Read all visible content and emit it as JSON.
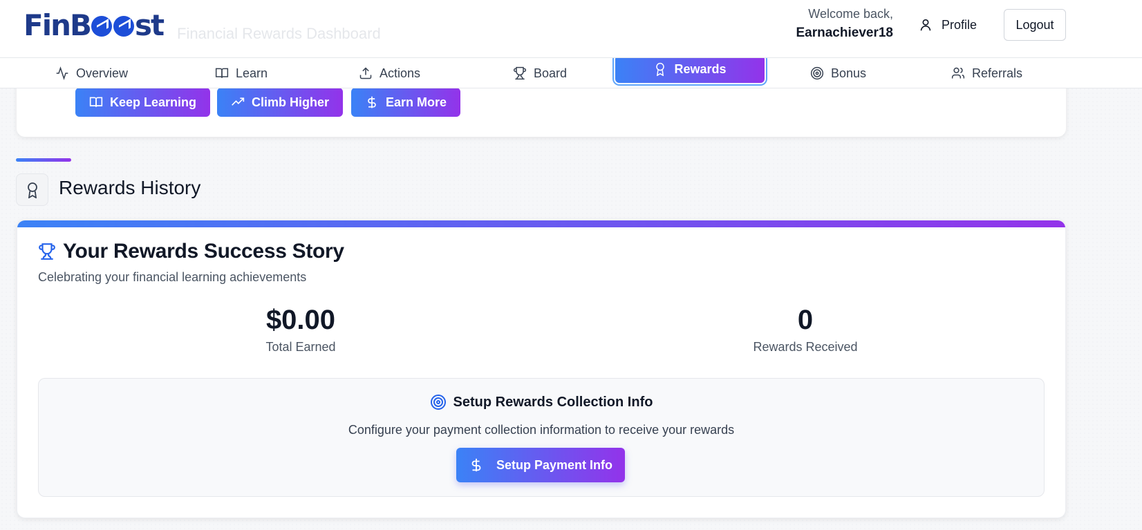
{
  "app": {
    "logo_text": "FinBoost",
    "logo_prefix": "FinB",
    "logo_suffix": "st"
  },
  "header": {
    "ghost_subtitle": "Financial Rewards Dashboard",
    "welcome_line": "Welcome back,",
    "username": "Earnachiever18",
    "profile_label": "Profile",
    "logout_label": "Logout"
  },
  "tabs": [
    {
      "label": "Overview",
      "icon": "activity-icon",
      "active": false
    },
    {
      "label": "Learn",
      "icon": "book-open-icon",
      "active": false
    },
    {
      "label": "Actions",
      "icon": "upload-icon",
      "active": false
    },
    {
      "label": "Board",
      "icon": "trophy-icon",
      "active": false
    },
    {
      "label": "Rewards",
      "icon": "award-icon",
      "active": true
    },
    {
      "label": "Bonus",
      "icon": "target-icon",
      "active": false
    },
    {
      "label": "Referrals",
      "icon": "users-icon",
      "active": false
    }
  ],
  "quick_actions": [
    {
      "label": "Keep Learning",
      "icon": "book-open-icon"
    },
    {
      "label": "Climb Higher",
      "icon": "trending-up-icon"
    },
    {
      "label": "Earn More",
      "icon": "dollar-sign-icon"
    }
  ],
  "section": {
    "title": "Rewards History",
    "icon": "award-icon"
  },
  "rewards_card": {
    "title": "Your Rewards Success Story",
    "subtitle": "Celebrating your financial learning achievements",
    "stats": [
      {
        "value": "$0.00",
        "label": "Total Earned"
      },
      {
        "value": "0",
        "label": "Rewards Received"
      }
    ],
    "setup": {
      "title": "Setup Rewards Collection Info",
      "description": "Configure your payment collection information to receive your rewards",
      "button_label": "Setup Payment Info"
    }
  },
  "colors": {
    "accent_start": "#3b82f6",
    "accent_end": "#9333ea",
    "brand": "#1e3a8a"
  }
}
